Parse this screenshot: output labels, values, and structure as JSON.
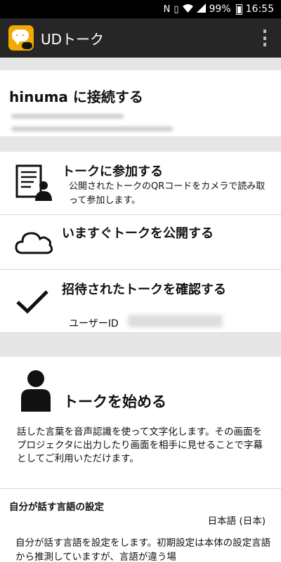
{
  "status_bar": {
    "nfc": "N",
    "battery_percent": "99%",
    "time": "16:55"
  },
  "app_bar": {
    "title": "UDトーク"
  },
  "connect": {
    "title": "hinuma に接続する"
  },
  "join_talk": {
    "title": "トークに参加する",
    "description": "公開されたトークのQRコードをカメラで読み取って参加します。"
  },
  "publish_talk": {
    "title": "いますぐトークを公開する"
  },
  "invited_talk": {
    "title": "招待されたトークを確認する",
    "user_id_label": "ユーザーID"
  },
  "start_talk": {
    "title": "トークを始める",
    "description": "話した言葉を音声認識を使って文字化します。その画面をプロジェクタに出力したり画面を相手に見せることで字幕としてご利用いただけます。"
  },
  "language": {
    "title": "自分が話す言語の設定",
    "value": "日本語 (日本)",
    "description": "自分が話す言語を設定をします。初期設定は本体の設定言語から推測していますが、言語が違う場"
  }
}
